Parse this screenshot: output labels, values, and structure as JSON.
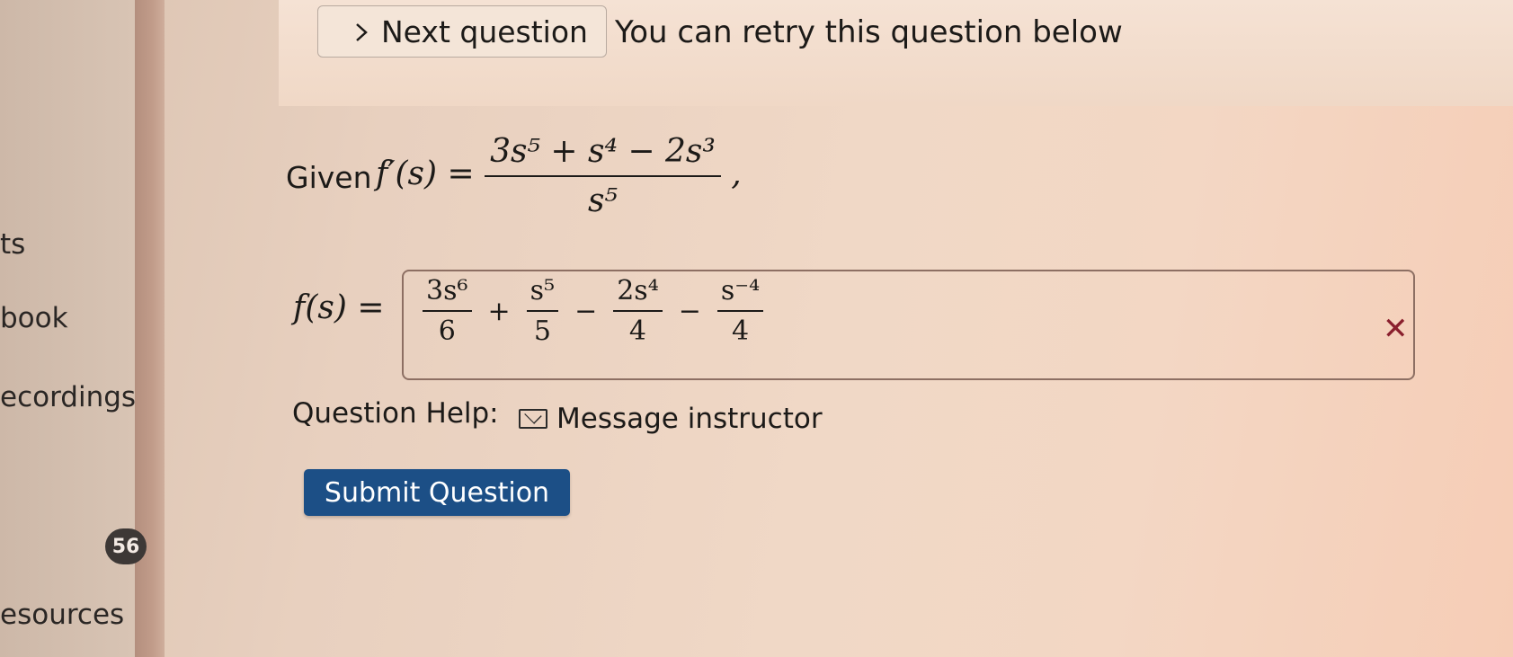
{
  "sidebar": {
    "items": [
      {
        "label": "ts"
      },
      {
        "label": "book"
      },
      {
        "label": "ecordings"
      },
      {
        "label": "esources"
      }
    ],
    "badge_count": "56"
  },
  "toolbar": {
    "next_question_label": "Next question",
    "next_question_icon": "chevron-right-icon",
    "retry_text": "You can retry this question below"
  },
  "question": {
    "given_label": "Given",
    "given_lhs": "f′(s) =",
    "given_numerator": "3s⁵ + s⁴ − 2s³",
    "given_denominator": "s⁵",
    "given_trailing": ",",
    "answer_lhs": "f(s) =",
    "answer_terms": [
      {
        "num": "3s⁶",
        "den": "6"
      },
      {
        "num": "s⁵",
        "den": "5"
      },
      {
        "num": "2s⁴",
        "den": "4"
      },
      {
        "num": "s⁻⁴",
        "den": "4"
      }
    ],
    "answer_operators": [
      "+",
      "−",
      "−"
    ],
    "answer_status_icon": "incorrect-x-icon",
    "answer_status_color": "#8a1f2d"
  },
  "help": {
    "label": "Question Help:",
    "message_instructor": "Message instructor",
    "message_icon": "envelope-icon"
  },
  "submit": {
    "label": "Submit Question",
    "color": "#1c4f86"
  }
}
